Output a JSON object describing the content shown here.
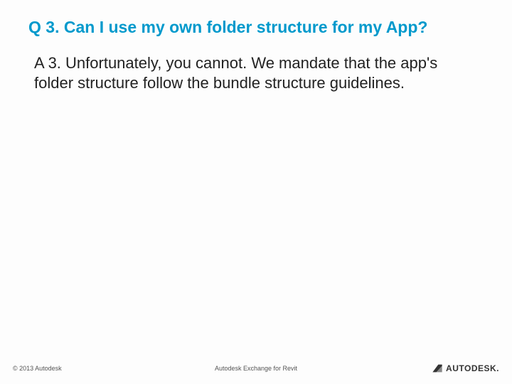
{
  "slide": {
    "question": "Q 3. Can I use my own folder structure for my App?",
    "answer": "A 3. Unfortunately, you cannot. We mandate that the app's folder structure follow the bundle structure guidelines."
  },
  "footer": {
    "copyright": "© 2013 Autodesk",
    "center": "Autodesk Exchange for Revit",
    "logo_text": "AUTODESK."
  }
}
